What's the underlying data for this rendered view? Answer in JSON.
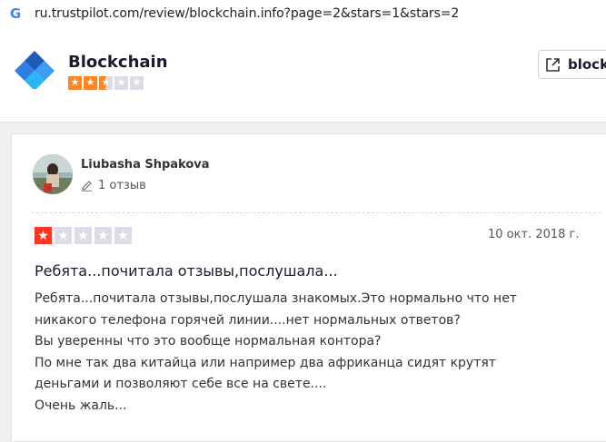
{
  "browser": {
    "url": "ru.trustpilot.com/review/blockchain.info?page=2&stars=1&stars=2",
    "google_icon": "G"
  },
  "business": {
    "name": "Blockchain",
    "rating_stars": 2.5,
    "visit_label": "blockc",
    "visit_icon": "external-link-icon"
  },
  "review": {
    "author": "Liubasha Shpakova",
    "review_count": "1 отзыв",
    "stars": 1,
    "date": "10 окт. 2018 г.",
    "title": "Ребята...почитала отзывы,послушала...",
    "body_lines": [
      "Ребята...почитала отзывы,послушала знакомых.Это нормально что нет",
      "никакого телефона горячей линии....нет нормальных ответов?",
      "Вы уверенны что это вообще нормальная контора?",
      "По мне так два китайца или например два африканца сидят крутят",
      "деньгами и позволяют себе все на свете....",
      "Очень жаль..."
    ]
  },
  "colors": {
    "star_orange": "#ff8622",
    "star_red": "#ff3722",
    "star_empty": "#dcdce6"
  }
}
